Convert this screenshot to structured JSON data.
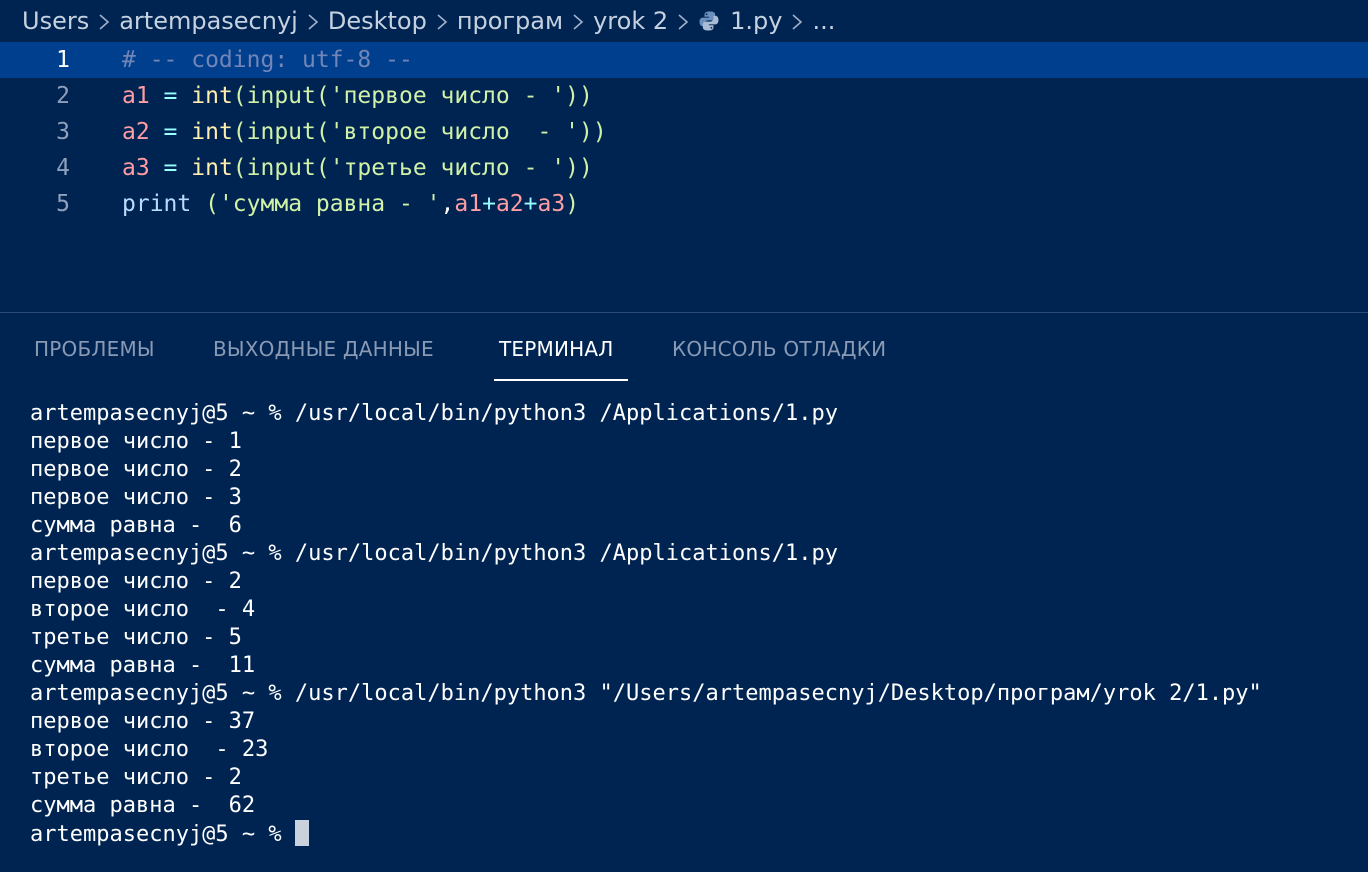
{
  "breadcrumb": {
    "items": [
      "Users",
      "artempasecnyj",
      "Desktop",
      "програм",
      "yrok 2"
    ],
    "file": "1.py",
    "ellipsis": "...",
    "file_icon": "python-icon"
  },
  "editor": {
    "lines": [
      {
        "n": "1",
        "tokens": [
          {
            "t": "# -- coding: utf-8 --",
            "c": "comment"
          }
        ]
      },
      {
        "n": "2",
        "tokens": [
          {
            "t": "a1",
            "c": "var"
          },
          {
            "t": " = ",
            "c": "op"
          },
          {
            "t": "int",
            "c": "func"
          },
          {
            "t": "(input(",
            "c": "plain"
          },
          {
            "t": "'первое число - '",
            "c": "str"
          },
          {
            "t": "))",
            "c": "plain"
          }
        ]
      },
      {
        "n": "3",
        "tokens": [
          {
            "t": "a2",
            "c": "var"
          },
          {
            "t": " = ",
            "c": "op"
          },
          {
            "t": "int",
            "c": "func"
          },
          {
            "t": "(input(",
            "c": "plain"
          },
          {
            "t": "'второе число  - '",
            "c": "str"
          },
          {
            "t": "))",
            "c": "plain"
          }
        ]
      },
      {
        "n": "4",
        "tokens": [
          {
            "t": "a3",
            "c": "var"
          },
          {
            "t": " = ",
            "c": "op"
          },
          {
            "t": "int",
            "c": "func"
          },
          {
            "t": "(input(",
            "c": "plain"
          },
          {
            "t": "'третье число - '",
            "c": "str"
          },
          {
            "t": "))",
            "c": "plain"
          }
        ]
      },
      {
        "n": "5",
        "tokens": [
          {
            "t": "print",
            "c": "id"
          },
          {
            "t": " (",
            "c": "plain"
          },
          {
            "t": "'сумма равна - '",
            "c": "str"
          },
          {
            "t": ",",
            "c": "punct"
          },
          {
            "t": "a1",
            "c": "var"
          },
          {
            "t": "+",
            "c": "op"
          },
          {
            "t": "a2",
            "c": "var"
          },
          {
            "t": "+",
            "c": "op"
          },
          {
            "t": "a3",
            "c": "var"
          },
          {
            "t": ")",
            "c": "plain"
          }
        ]
      }
    ]
  },
  "panel": {
    "tabs": [
      "ПРОБЛЕМЫ",
      "ВЫХОДНЫЕ ДАННЫЕ",
      "ТЕРМИНАЛ",
      "КОНСОЛЬ ОТЛАДКИ"
    ],
    "active_tab": "ТЕРМИНАЛ"
  },
  "terminal": {
    "lines": [
      "artempasecnyj@5 ~ % /usr/local/bin/python3 /Applications/1.py",
      "первое число - 1",
      "первое число - 2",
      "первое число - 3",
      "сумма равна -  6",
      "artempasecnyj@5 ~ % /usr/local/bin/python3 /Applications/1.py",
      "первое число - 2",
      "второе число  - 4",
      "третье число - 5",
      "сумма равна -  11",
      "artempasecnyj@5 ~ % /usr/local/bin/python3 \"/Users/artempasecnyj/Desktop/програм/yrok 2/1.py\"",
      "первое число - 37",
      "второе число  - 23",
      "третье число - 2",
      "сумма равна -  62"
    ],
    "prompt": "artempasecnyj@5 ~ % "
  },
  "colors": {
    "background": "#002451",
    "current_line": "#003f8e",
    "comment": "#7285b7",
    "variable": "#ff9da4",
    "string": "#d1f1a9",
    "function": "#ffeead",
    "operator": "#99ffff"
  }
}
